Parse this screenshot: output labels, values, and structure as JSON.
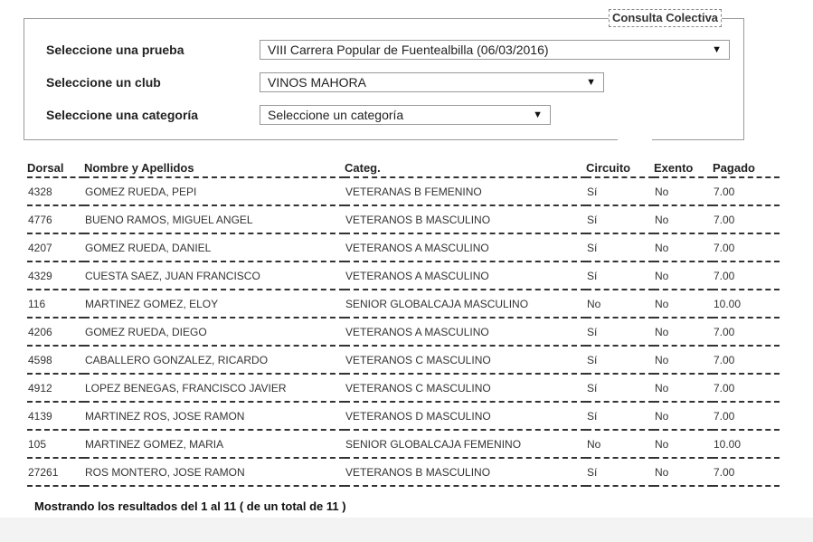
{
  "form": {
    "legend": "Consulta Colectiva",
    "prueba_label": "Seleccione una prueba",
    "prueba_value": "VIII Carrera Popular de Fuentealbilla (06/03/2016)",
    "club_label": "Seleccione un club",
    "club_value": "VINOS MAHORA",
    "categoria_label": "Seleccione una categoría",
    "categoria_value": "Seleccione un categoría",
    "dropdown_icon": "triangle-down-icon"
  },
  "table": {
    "headers": [
      "Dorsal",
      "Nombre y Apellidos",
      "Categ.",
      "Circuito",
      "Exento",
      "Pagado"
    ],
    "rows": [
      [
        "4328",
        "GOMEZ RUEDA, PEPI",
        "VETERANAS B FEMENINO",
        "Sí",
        "No",
        "7.00"
      ],
      [
        "4776",
        "BUENO RAMOS, MIGUEL ANGEL",
        "VETERANOS B MASCULINO",
        "Sí",
        "No",
        "7.00"
      ],
      [
        "4207",
        "GOMEZ RUEDA, DANIEL",
        "VETERANOS A MASCULINO",
        "Sí",
        "No",
        "7.00"
      ],
      [
        "4329",
        "CUESTA SAEZ, JUAN FRANCISCO",
        "VETERANOS A MASCULINO",
        "Sí",
        "No",
        "7.00"
      ],
      [
        "116",
        "MARTINEZ GOMEZ, ELOY",
        "SENIOR GLOBALCAJA MASCULINO",
        "No",
        "No",
        "10.00"
      ],
      [
        "4206",
        "GOMEZ RUEDA, DIEGO",
        "VETERANOS A MASCULINO",
        "Sí",
        "No",
        "7.00"
      ],
      [
        "4598",
        "CABALLERO GONZALEZ, RICARDO",
        "VETERANOS C MASCULINO",
        "Sí",
        "No",
        "7.00"
      ],
      [
        "4912",
        "LOPEZ BENEGAS, FRANCISCO JAVIER",
        "VETERANOS C MASCULINO",
        "Sí",
        "No",
        "7.00"
      ],
      [
        "4139",
        "MARTINEZ ROS, JOSE RAMON",
        "VETERANOS D MASCULINO",
        "Sí",
        "No",
        "7.00"
      ],
      [
        "105",
        "MARTINEZ GOMEZ, MARIA",
        "SENIOR GLOBALCAJA FEMENINO",
        "No",
        "No",
        "10.00"
      ],
      [
        "27261",
        "ROS MONTERO, JOSE RAMON",
        "VETERANOS B MASCULINO",
        "Sí",
        "No",
        "7.00"
      ]
    ]
  },
  "footer": {
    "summary": "Mostrando los resultados del 1 al 11 ( de un total de 11 )"
  }
}
